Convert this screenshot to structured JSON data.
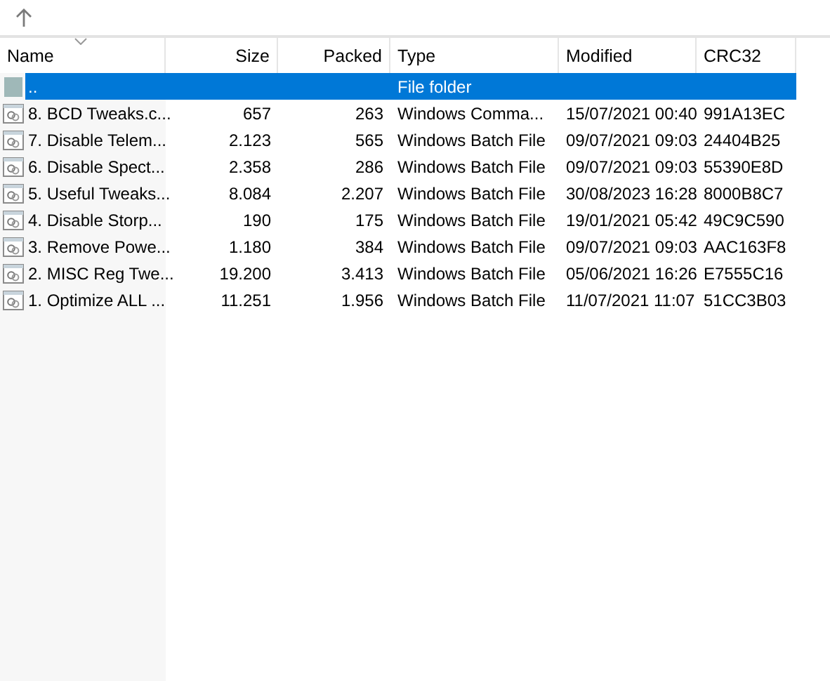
{
  "columns": [
    {
      "label": "Name",
      "sorted": true
    },
    {
      "label": "Size",
      "sorted": false
    },
    {
      "label": "Packed",
      "sorted": false
    },
    {
      "label": "Type",
      "sorted": false
    },
    {
      "label": "Modified",
      "sorted": false
    },
    {
      "label": "CRC32",
      "sorted": false
    }
  ],
  "rows": [
    {
      "kind": "folder",
      "selected": true,
      "cells": [
        "..",
        "",
        "",
        "File folder",
        "",
        ""
      ]
    },
    {
      "kind": "file",
      "selected": false,
      "cells": [
        "8. BCD Tweaks.c...",
        "657",
        "263",
        "Windows Comma...",
        "15/07/2021 00:40",
        "991A13EC"
      ]
    },
    {
      "kind": "file",
      "selected": false,
      "cells": [
        "7. Disable Telem...",
        "2.123",
        "565",
        "Windows Batch File",
        "09/07/2021 09:03",
        "24404B25"
      ]
    },
    {
      "kind": "file",
      "selected": false,
      "cells": [
        "6. Disable Spect...",
        "2.358",
        "286",
        "Windows Batch File",
        "09/07/2021 09:03",
        "55390E8D"
      ]
    },
    {
      "kind": "file",
      "selected": false,
      "cells": [
        "5. Useful Tweaks...",
        "8.084",
        "2.207",
        "Windows Batch File",
        "30/08/2023 16:28",
        "8000B8C7"
      ]
    },
    {
      "kind": "file",
      "selected": false,
      "cells": [
        "4. Disable Storp...",
        "190",
        "175",
        "Windows Batch File",
        "19/01/2021 05:42",
        "49C9C590"
      ]
    },
    {
      "kind": "file",
      "selected": false,
      "cells": [
        "3. Remove Powe...",
        "1.180",
        "384",
        "Windows Batch File",
        "09/07/2021 09:03",
        "AAC163F8"
      ]
    },
    {
      "kind": "file",
      "selected": false,
      "cells": [
        "2. MISC Reg Twe...",
        "19.200",
        "3.413",
        "Windows Batch File",
        "05/06/2021 16:26",
        "E7555C16"
      ]
    },
    {
      "kind": "file",
      "selected": false,
      "cells": [
        "1. Optimize ALL ...",
        "11.251",
        "1.956",
        "Windows Batch File",
        "11/07/2021 11:07",
        "51CC3B03"
      ]
    }
  ]
}
